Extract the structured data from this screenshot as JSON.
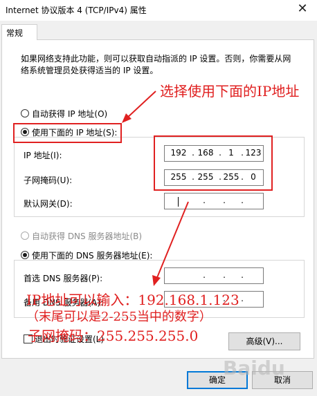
{
  "window": {
    "title": "Internet 协议版本 4 (TCP/IPv4) 属性",
    "close_glyph": "✕"
  },
  "tabs": [
    {
      "label": "常规",
      "selected": true
    }
  ],
  "description": "如果网络支持此功能，则可以获取自动指派的 IP 设置。否则，你需要从网络系统管理员处获得适当的 IP 设置。",
  "ip_section": {
    "auto_label": "自动获得 IP 地址(O)",
    "manual_label": "使用下面的 IP 地址(S):",
    "selected": "manual",
    "fields": [
      {
        "label": "IP 地址(I):",
        "octets": [
          "192",
          "168",
          "1",
          "123"
        ]
      },
      {
        "label": "子网掩码(U):",
        "octets": [
          "255",
          "255",
          "255",
          "0"
        ]
      },
      {
        "label": "默认网关(D):",
        "octets": [
          "",
          "",
          "",
          ""
        ]
      }
    ]
  },
  "dns_section": {
    "auto_label": "自动获得 DNS 服务器地址(B)",
    "manual_label": "使用下面的 DNS 服务器地址(E):",
    "selected": "manual",
    "fields": [
      {
        "label": "首选 DNS 服务器(P):",
        "octets": [
          "",
          "",
          "",
          ""
        ]
      },
      {
        "label": "备用 DNS 服务器(A):",
        "octets": [
          "",
          "",
          "",
          ""
        ]
      }
    ]
  },
  "validate_on_exit": {
    "label": "退出时验证设置(L)",
    "checked": false
  },
  "buttons": {
    "advanced": "高级(V)...",
    "ok": "确定",
    "cancel": "取消"
  },
  "annotations": {
    "arrow_label": "选择使用下面的IP地址",
    "note_lines": [
      "IP地址可以输入：192.168.1.123",
      "（末尾可以是2-255当中的数字）",
      "子网掩码：255.255.255.0"
    ],
    "color": "#e02020"
  },
  "watermark": "Baidu"
}
